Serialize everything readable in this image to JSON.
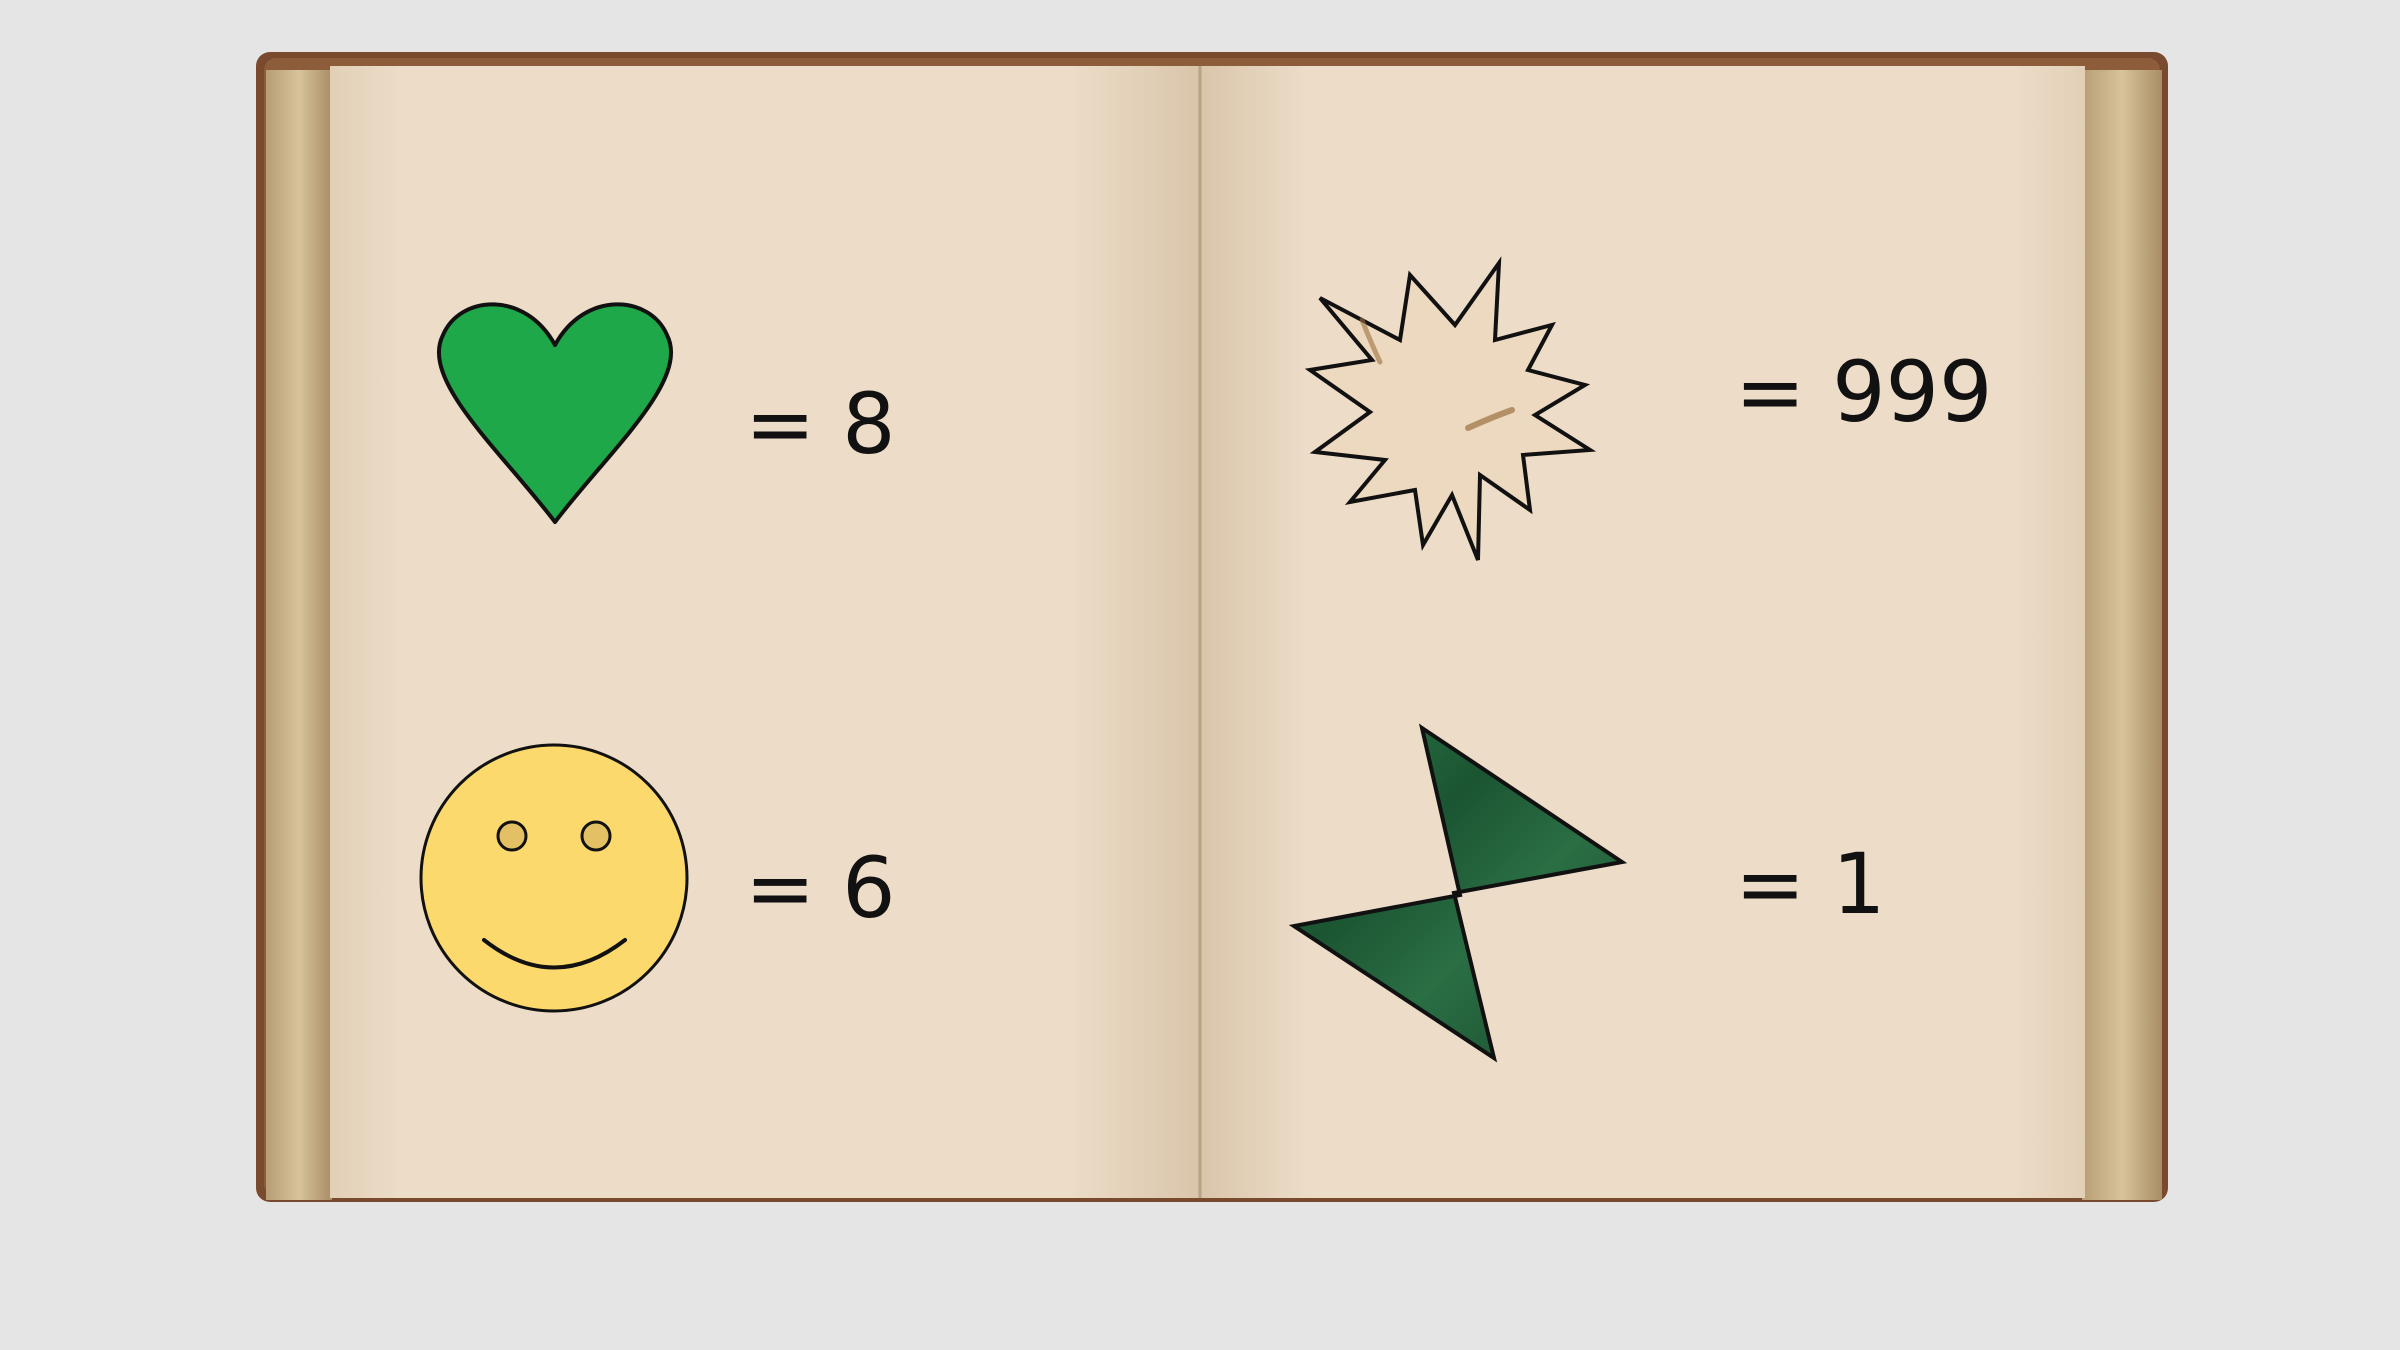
{
  "puzzle": {
    "equations": [
      {
        "symbol": "heart-icon",
        "label": "= 8"
      },
      {
        "symbol": "smiley-icon",
        "label": "= 6"
      },
      {
        "symbol": "starburst-icon",
        "label": "= 999"
      },
      {
        "symbol": "bowtie-icon",
        "label": "= 1"
      }
    ]
  },
  "colors": {
    "background": "#e5e5e5",
    "page": "#ecdcc8",
    "cover": "#8a5a3a",
    "heart": "#1ea84a",
    "smiley": "#fcd96c",
    "starburst": "#ecd9bf",
    "bowtie": "#1f5e38",
    "outline": "#111111"
  }
}
